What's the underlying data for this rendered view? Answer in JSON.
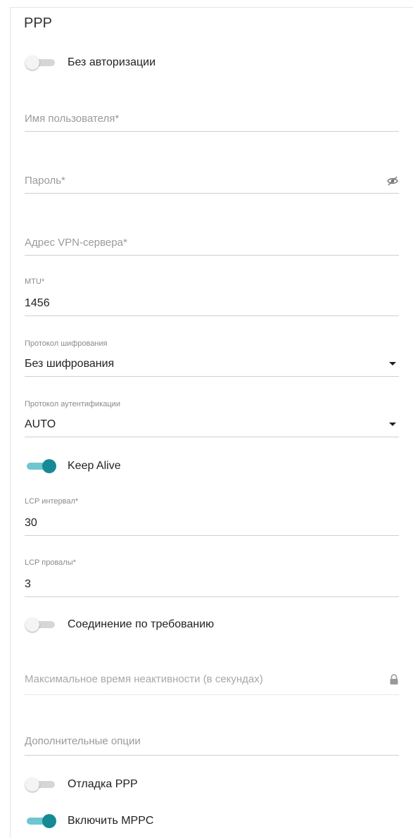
{
  "section_title": "PPP",
  "no_auth": {
    "label": "Без авторизации",
    "enabled": false
  },
  "username": {
    "placeholder": "Имя пользователя*",
    "value": ""
  },
  "password": {
    "placeholder": "Пароль*",
    "value": "",
    "icon": "eye-off-icon"
  },
  "vpn_server": {
    "placeholder": "Адрес VPN-сервера*",
    "value": ""
  },
  "mtu": {
    "label": "MTU*",
    "value": "1456"
  },
  "encryption": {
    "label": "Протокол шифрования",
    "value": "Без шифрования"
  },
  "auth_protocol": {
    "label": "Протокол аутентификации",
    "value": "AUTO"
  },
  "keep_alive": {
    "label": "Keep Alive",
    "enabled": true
  },
  "lcp_interval": {
    "label": "LCP интервал*",
    "value": "30"
  },
  "lcp_failures": {
    "label": "LCP провалы*",
    "value": "3"
  },
  "on_demand": {
    "label": "Соединение по требованию",
    "enabled": false
  },
  "max_idle": {
    "placeholder": "Максимальное время неактивности (в секундах)",
    "icon": "lock-icon"
  },
  "extra_options": {
    "placeholder": "Дополнительные опции",
    "value": ""
  },
  "ppp_debug": {
    "label": "Отладка PPP",
    "enabled": false
  },
  "mppc": {
    "label": "Включить MPPC",
    "enabled": true
  },
  "colors": {
    "accent": "#158a96",
    "accent_light": "#6ec6d0",
    "toggle_off": "#d6d6d6"
  }
}
